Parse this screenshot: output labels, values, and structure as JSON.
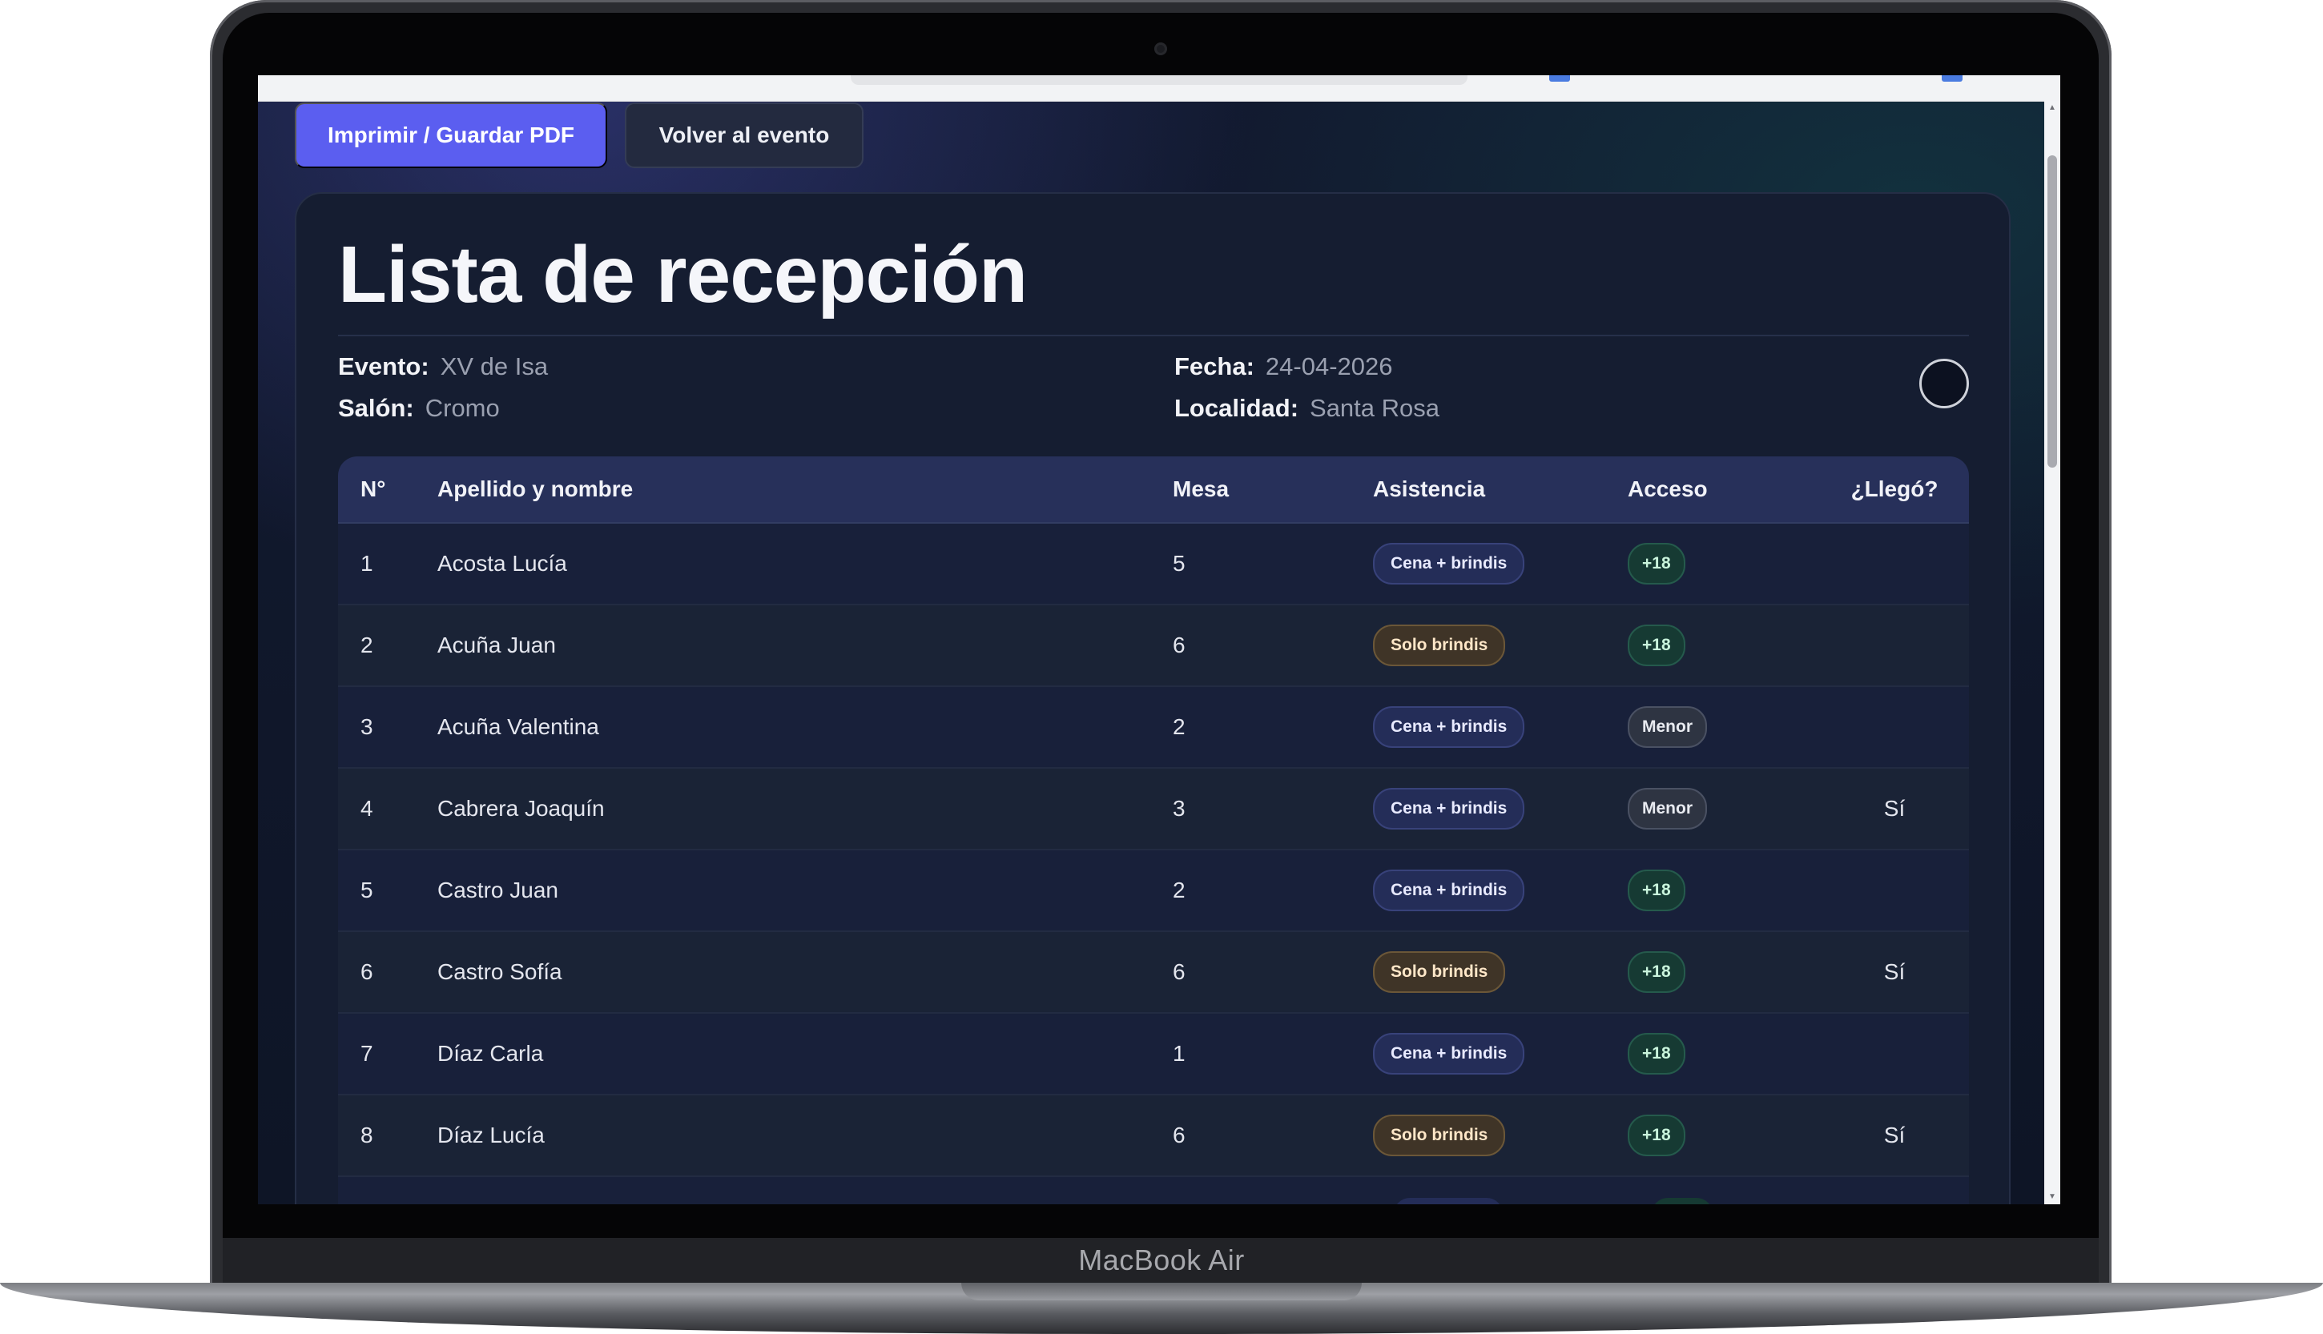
{
  "device": {
    "brand_label": "MacBook Air"
  },
  "toolbar": {
    "print_label": "Imprimir / Guardar PDF",
    "back_label": "Volver al evento"
  },
  "page": {
    "title": "Lista de recepción",
    "meta": {
      "evento_label": "Evento:",
      "evento": "XV de Isa",
      "salon_label": "Salón:",
      "salon": "Cromo",
      "fecha_label": "Fecha:",
      "fecha": "24-04-2026",
      "localidad_label": "Localidad:",
      "localidad": "Santa Rosa"
    }
  },
  "table": {
    "headers": [
      "N°",
      "Apellido y nombre",
      "Mesa",
      "Asistencia",
      "Acceso",
      "¿Llegó?"
    ],
    "rows": [
      {
        "num": "1",
        "name": "Acosta Lucía",
        "mesa": "5",
        "asistencia": "Cena + brindis",
        "acceso": "+18",
        "llego": ""
      },
      {
        "num": "2",
        "name": "Acuña Juan",
        "mesa": "6",
        "asistencia": "Solo brindis",
        "acceso": "+18",
        "llego": ""
      },
      {
        "num": "3",
        "name": "Acuña Valentina",
        "mesa": "2",
        "asistencia": "Cena + brindis",
        "acceso": "Menor",
        "llego": ""
      },
      {
        "num": "4",
        "name": "Cabrera Joaquín",
        "mesa": "3",
        "asistencia": "Cena + brindis",
        "acceso": "Menor",
        "llego": "Sí"
      },
      {
        "num": "5",
        "name": "Castro Juan",
        "mesa": "2",
        "asistencia": "Cena + brindis",
        "acceso": "+18",
        "llego": ""
      },
      {
        "num": "6",
        "name": "Castro Sofía",
        "mesa": "6",
        "asistencia": "Solo brindis",
        "acceso": "+18",
        "llego": "Sí"
      },
      {
        "num": "7",
        "name": "Díaz Carla",
        "mesa": "1",
        "asistencia": "Cena + brindis",
        "acceso": "+18",
        "llego": ""
      },
      {
        "num": "8",
        "name": "Díaz Lucía",
        "mesa": "6",
        "asistencia": "Solo brindis",
        "acceso": "+18",
        "llego": "Sí"
      }
    ]
  },
  "colors": {
    "primary_button": "#5b5ef0",
    "background": "#121a30",
    "header_row": "#27305a"
  }
}
